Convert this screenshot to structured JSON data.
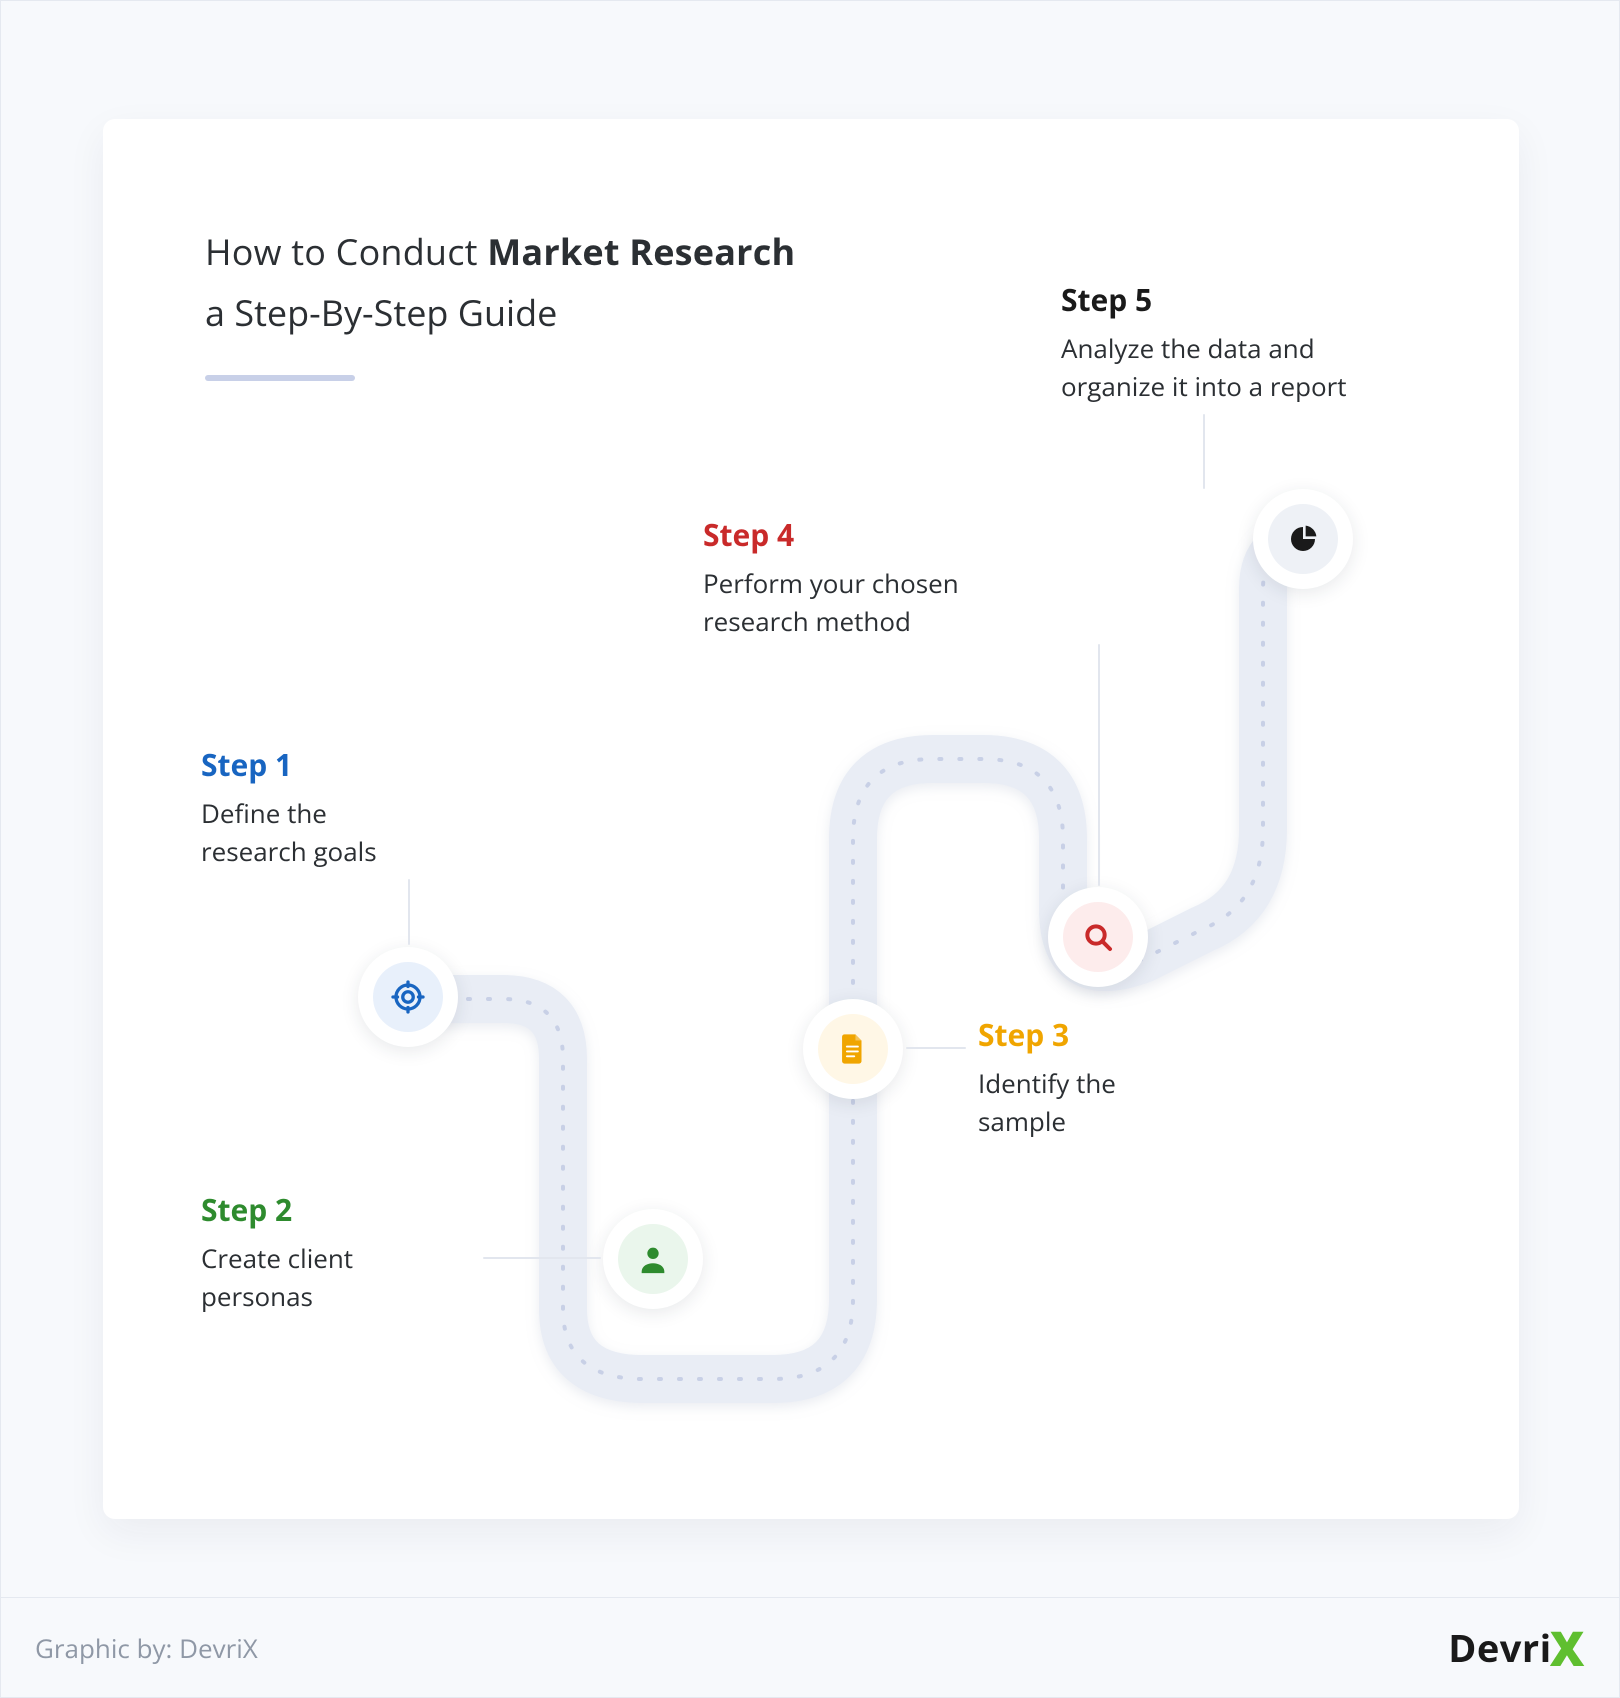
{
  "header": {
    "line1_prefix": "How to Conduct ",
    "line1_bold": "Market Research",
    "line2": "a Step-By-Step Guide"
  },
  "steps": [
    {
      "title": "Step 1",
      "desc": "Define the research goals",
      "color": "#1865c1",
      "icon": "target"
    },
    {
      "title": "Step 2",
      "desc": "Create client personas",
      "color": "#2e8b2e",
      "icon": "person"
    },
    {
      "title": "Step 3",
      "desc": "Identify the sample",
      "color": "#f0a500",
      "icon": "document"
    },
    {
      "title": "Step 4",
      "desc": "Perform your chosen research method",
      "color": "#c92a2a",
      "icon": "search"
    },
    {
      "title": "Step 5",
      "desc": "Analyze the data and organize it into a report",
      "color": "#1a1a1a",
      "icon": "pie"
    }
  ],
  "footer": {
    "credit_label": "Graphic by: ",
    "credit_name": "DevriX",
    "brand": "Devri"
  }
}
